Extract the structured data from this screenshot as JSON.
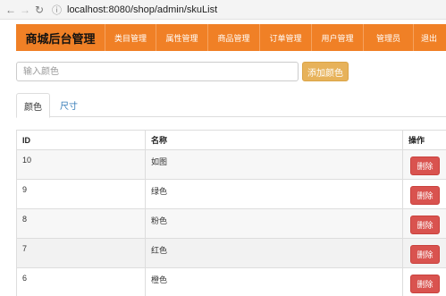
{
  "browser": {
    "url": "localhost:8080/shop/admin/skuList"
  },
  "navbar": {
    "brand": "商城后台管理",
    "items": [
      "类目管理",
      "属性管理",
      "商品管理",
      "订单管理",
      "用户管理",
      "管理员",
      "退出"
    ]
  },
  "search": {
    "placeholder": "输入颜色",
    "value": "",
    "add_label": "添加颜色"
  },
  "tabs": [
    {
      "label": "颜色",
      "active": true
    },
    {
      "label": "尺寸",
      "active": false
    }
  ],
  "table": {
    "headers": [
      "ID",
      "名称",
      "操作"
    ],
    "rows": [
      {
        "id": "10",
        "name": "如图",
        "action": "删除"
      },
      {
        "id": "9",
        "name": "绿色",
        "action": "删除"
      },
      {
        "id": "8",
        "name": "粉色",
        "action": "删除"
      },
      {
        "id": "7",
        "name": "红色",
        "action": "删除"
      },
      {
        "id": "6",
        "name": "橙色",
        "action": "删除"
      }
    ]
  },
  "colors": {
    "navbar": "#f08026",
    "add_button": "#e7b25a",
    "delete_button": "#d9534f",
    "link": "#337ab7"
  }
}
